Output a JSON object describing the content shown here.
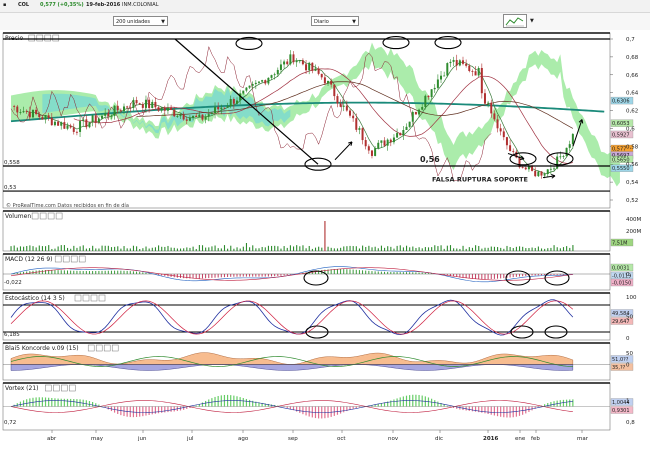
{
  "header": {
    "symbol": "COL",
    "price": "0,577 (+0,35%)",
    "date": "19-feb-2016",
    "name": "INM.COLONIAL",
    "units_select": "200 unidades",
    "period_select": "Diario"
  },
  "panels": {
    "price": {
      "label": "Precio",
      "axis_ticks": [
        "0,7",
        "0,68",
        "0,66",
        "0,64",
        "0,62",
        "0,6",
        "0,58",
        "0,56",
        "0,54",
        "0,52"
      ],
      "badges": [
        {
          "text": "0,6306",
          "color": "#9ed6e8"
        },
        {
          "text": "0,6053",
          "color": "#b5e8a8"
        },
        {
          "text": "0,5927",
          "color": "#e8c0d0"
        },
        {
          "text": "0,577",
          "color": "#f4a030"
        },
        {
          "text": "0,5697",
          "color": "#c9a8d8"
        },
        {
          "text": "0,5650",
          "color": "#b5e8a8"
        },
        {
          "text": "0,5550",
          "color": "#9ed6e8"
        }
      ],
      "left_value_1": "0,558",
      "left_value_2": "0,53",
      "annotation_level": "0,56",
      "annotation_text": "FALSA RUPTURA SOPORTE",
      "footer": "© ProRealTime.com  Datos recibidos en fin de día"
    },
    "volume": {
      "label": "Volumen",
      "ticks": [
        "400M",
        "200M"
      ],
      "badge": {
        "text": "7,51M",
        "color": "#9ed680"
      }
    },
    "macd": {
      "label": "MACD (12 26 9)",
      "left_value": "-0,022",
      "ticks": [
        "0"
      ],
      "badges": [
        {
          "text": "0,0031",
          "color": "#b5e8a8"
        },
        {
          "text": "-0,0119",
          "color": "#c0d8f0"
        },
        {
          "text": "-0,0150",
          "color": "#f0b0c8"
        }
      ]
    },
    "stoch": {
      "label": "Estocástico (14 3 5)",
      "left_value": "6,185",
      "ticks": [
        "100",
        "50",
        "0"
      ],
      "badges": [
        {
          "text": "49,584",
          "color": "#c0d0f0"
        },
        {
          "text": "29,647",
          "color": "#f4b8b8"
        }
      ]
    },
    "blai5": {
      "label": "Blai5 Koncorde v.09 (15)",
      "ticks": [
        "50",
        "0"
      ],
      "badges": [
        {
          "text": "51,0??",
          "color": "#c0d0f0"
        },
        {
          "text": "35,??",
          "color": "#f4c0a0"
        }
      ]
    },
    "vortex": {
      "label": "Vortex (21)",
      "left_value": "0,72",
      "ticks": [
        "1",
        "0,8"
      ],
      "badges": [
        {
          "text": "1,0044",
          "color": "#c0d0f0"
        },
        {
          "text": "0,9301",
          "color": "#f4b8c8"
        }
      ]
    }
  },
  "x_axis": [
    "abr",
    "may",
    "jun",
    "jul",
    "ago",
    "sep",
    "oct",
    "nov",
    "dic",
    "2016",
    "ene",
    "feb",
    "mar"
  ],
  "colors": {
    "up": "#2e8b2e",
    "down": "#b03030",
    "ema200": "#1a8a7a",
    "cloud_green": "#66dd66",
    "cloud_cyan": "#55ccee"
  }
}
